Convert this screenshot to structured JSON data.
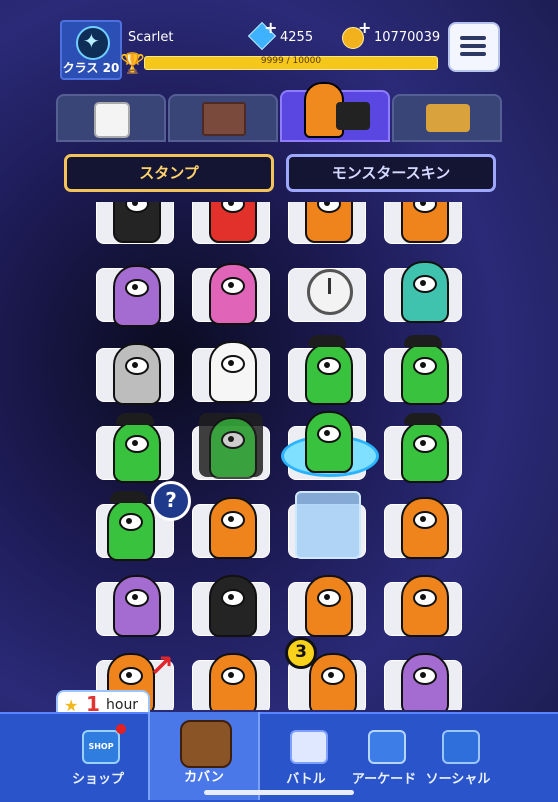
{
  "player": {
    "name": "Scarlet",
    "rank_label": "クラス 20",
    "gems": "4255",
    "coins": "10770039",
    "xp_text": "9999 / 10000"
  },
  "category_tabs": [
    {
      "name": "dice",
      "icon": "dice-icon",
      "active": false
    },
    {
      "name": "board",
      "icon": "board-icon",
      "active": false
    },
    {
      "name": "stamp",
      "icon": "mascot-icon",
      "active": true
    },
    {
      "name": "items",
      "icon": "item-pack-icon",
      "active": false
    }
  ],
  "sub_tabs": {
    "stamps": "スタンプ",
    "monster_skins": "モンスタースキン"
  },
  "stamp_badges": {
    "question": "?",
    "count": "3"
  },
  "timer": {
    "value": "1",
    "unit": "hour"
  },
  "nav": {
    "shop_label": "ショップ",
    "shop_sign": "SHOP",
    "bag_label": "カバン",
    "battle_label": "バトル",
    "arcade_label": "アーケード",
    "social_label": "ソーシャル"
  },
  "colors": {
    "accent_gold": "#f2c35a",
    "nav_blue": "#2a54c9",
    "active_tab": "#5a46e0"
  }
}
